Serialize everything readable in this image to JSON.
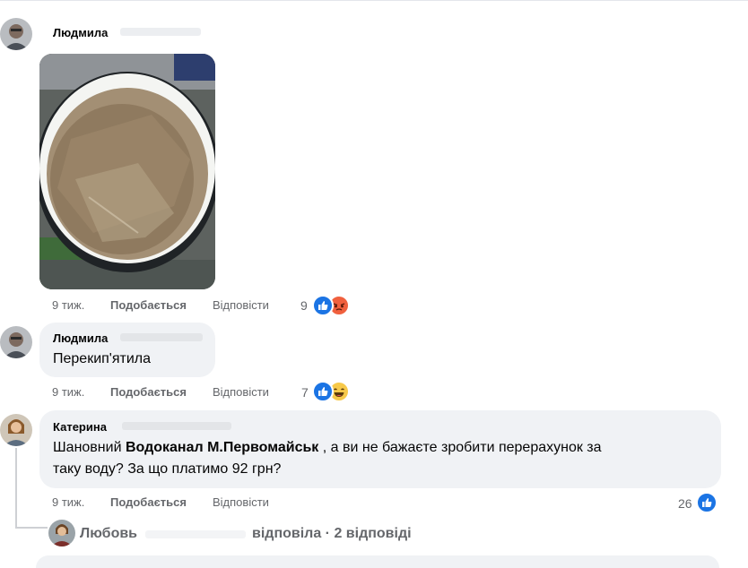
{
  "comments": [
    {
      "author": "Людмила",
      "has_photo": true,
      "time": "9 тиж.",
      "like_label": "Подобається",
      "reply_label": "Відповісти",
      "reaction_count": "9",
      "reactions": [
        "like-icon",
        "angry-icon"
      ]
    },
    {
      "author": "Людмила",
      "text": "Перекип'ятила",
      "time": "9 тиж.",
      "like_label": "Подобається",
      "reply_label": "Відповісти",
      "reaction_count": "7",
      "reactions": [
        "like-icon",
        "haha-icon"
      ]
    },
    {
      "author": "Катерина",
      "text_before": "Шановний ",
      "mention": "Водоканал М.Первомайськ",
      "text_line1_after": " , а ви не бажаєте зробити перерахунок за",
      "text_line2": "таку воду? За що платимо 92 грн?",
      "time": "9 тиж.",
      "like_label": "Подобається",
      "reply_label": "Відповісти",
      "reaction_count": "26",
      "reactions": [
        "like-icon"
      ]
    }
  ],
  "replies_summary": {
    "author": "Любовь",
    "text": "відповіла · 2 відповіді"
  },
  "colors": {
    "bubble": "#f0f2f5",
    "meta": "#65676b",
    "like": "#1b74e4",
    "angry": "#f0603e",
    "haha": "#f7c94a"
  }
}
